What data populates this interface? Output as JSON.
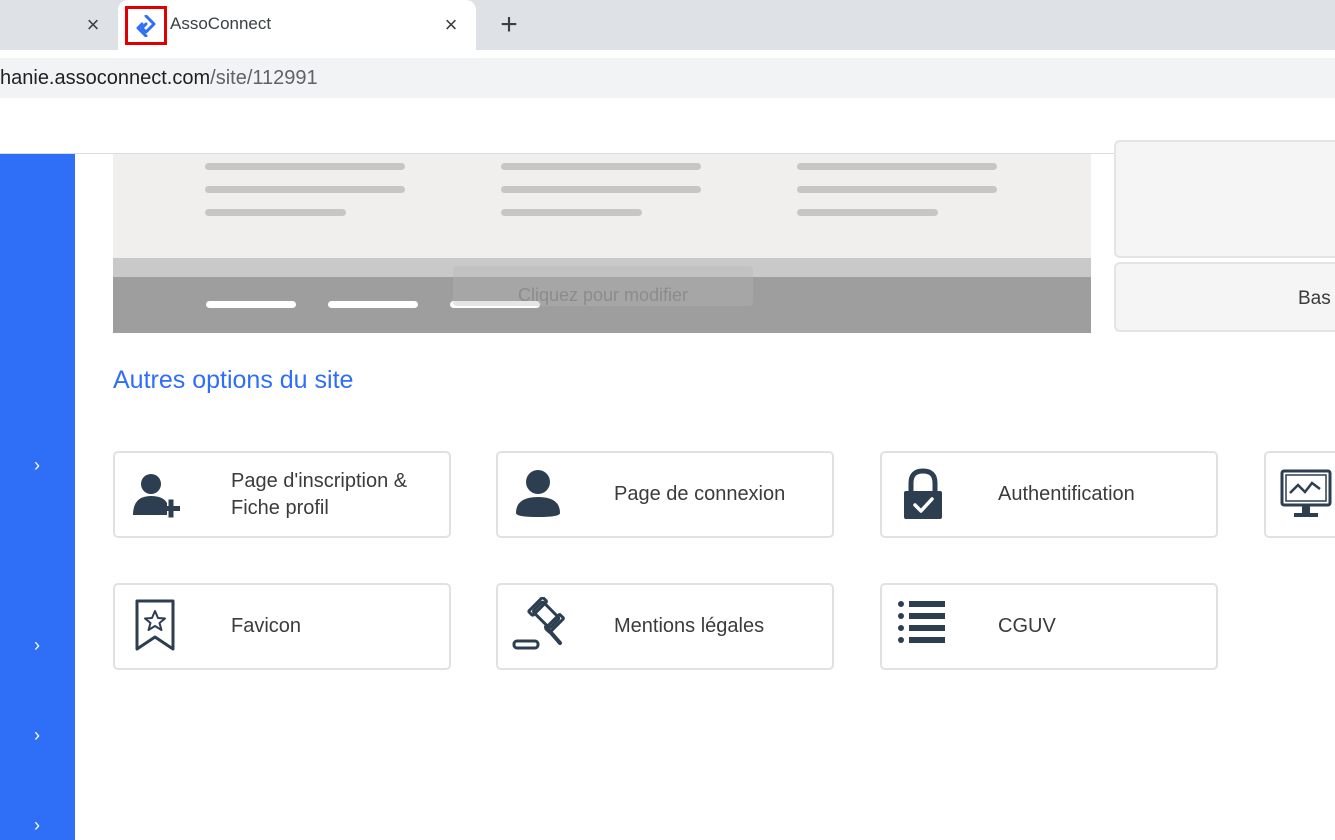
{
  "browser": {
    "tab_title": "AssoConnect",
    "close_symbol": "×",
    "new_tab_symbol": "+",
    "url_host": "hanie.assoconnect.com",
    "url_path": "/site/112991"
  },
  "preview": {
    "overlay_label": "Cliquez pour modifier"
  },
  "right_card": {
    "label": "Bas"
  },
  "section": {
    "title": "Autres options du site"
  },
  "cards": [
    {
      "label": "Page d'inscription & Fiche profil",
      "icon": "user-plus-icon"
    },
    {
      "label": "Page de connexion",
      "icon": "user-icon"
    },
    {
      "label": "Authentification",
      "icon": "lock-check-icon"
    },
    {
      "label": "",
      "icon": "monitor-chart-icon"
    },
    {
      "label": "Favicon",
      "icon": "bookmark-star-icon"
    },
    {
      "label": "Mentions légales",
      "icon": "gavel-icon"
    },
    {
      "label": "CGUV",
      "icon": "list-icon"
    }
  ],
  "sidebar": {
    "chevron_symbol": "›"
  },
  "colors": {
    "accent": "#2f6ef6",
    "icon": "#2c3e50",
    "sidebar": "#2f6ef6"
  }
}
